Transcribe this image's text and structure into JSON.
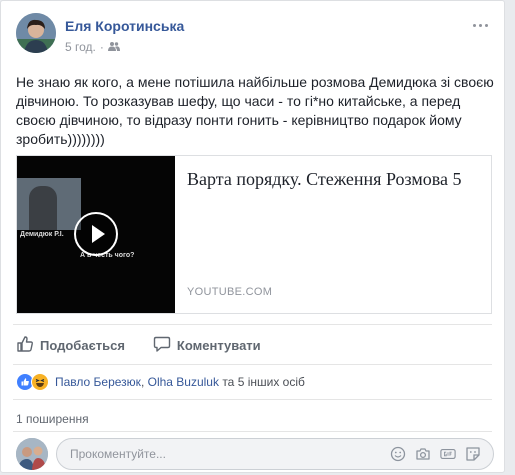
{
  "post": {
    "author": "Еля Коротинська",
    "time": "5 год.",
    "text": "Не знаю як кого, а мене потішила найбільше розмова Демидюка зі своєю дівчиною. То розказував шефу, що часи - то гі*но китайське, а перед своєю дівчиною, то відразу понти гонить - керівництво подарок йому зробить))))))))"
  },
  "link": {
    "title": "Варта порядку. Стеження Розмова 5",
    "domain": "YOUTUBE.COM",
    "thumb_caption_1": "Демидюк Р.І.",
    "thumb_caption_2": "А в честь чого?"
  },
  "actions": {
    "like": "Подобається",
    "comment": "Коментувати"
  },
  "reactions": {
    "name1": "Павло Березюк",
    "sep": ", ",
    "name2": "Olha Buzuluk",
    "others": " та 5 інших осіб"
  },
  "shares": "1 поширення",
  "comment_box": {
    "placeholder": "Прокоментуйте..."
  },
  "colors": {
    "link_blue": "#365899",
    "like_blue": "#4080ff",
    "haha_yellow": "#f7b125"
  }
}
